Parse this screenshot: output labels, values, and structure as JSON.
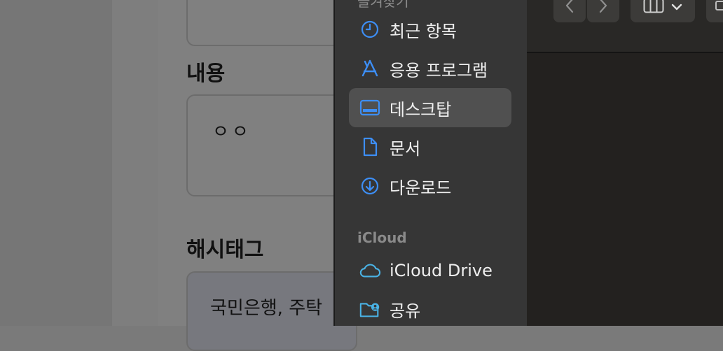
{
  "background_form": {
    "content_heading": "내용",
    "content_value": "ㅇㅇ",
    "hashtag_heading": "해시태그",
    "hashtag_value": "국민은행, 주탁"
  },
  "sidebar": {
    "partial_header": "즐겨찾기",
    "favorites": [
      {
        "label": "최근 항목",
        "icon": "clock-icon"
      },
      {
        "label": "응용 프로그램",
        "icon": "app-store-a-icon"
      },
      {
        "label": "데스크탑",
        "icon": "desktop-icon",
        "selected": true
      },
      {
        "label": "문서",
        "icon": "document-icon"
      },
      {
        "label": "다운로드",
        "icon": "download-circle-icon"
      }
    ],
    "icloud_section_title": "iCloud",
    "icloud": [
      {
        "label": "iCloud Drive",
        "icon": "cloud-icon"
      },
      {
        "label": "공유",
        "icon": "shared-folder-icon"
      }
    ]
  },
  "toolbar": {
    "back": "chevron-left-icon",
    "forward": "chevron-right-icon",
    "view": "column-view-icon",
    "view_menu": "chevron-down-icon"
  },
  "colors": {
    "accent": "#3d8ef5",
    "icloud_accent": "#4ab3e6",
    "sidebar_bg": "#363636",
    "selected_bg": "#505050"
  }
}
